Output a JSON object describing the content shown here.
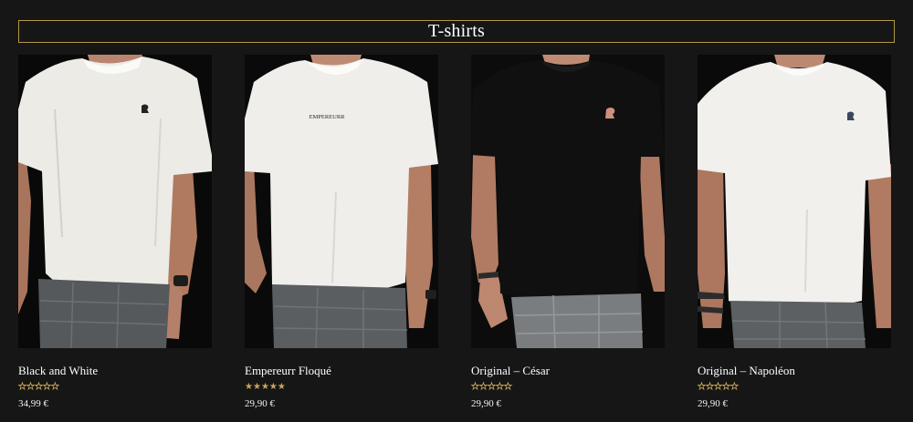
{
  "section": {
    "title": "T-shirts"
  },
  "colors": {
    "background": "#161616",
    "accent_gold": "#b39a45",
    "star_gold": "#c9a758"
  },
  "products": [
    {
      "name": "Black and White",
      "price": "34,99 €",
      "rating": 0,
      "shirt_color": "white",
      "print": "black-bust-logo-icon"
    },
    {
      "name": "Empereurr Floqué",
      "price": "29,90 €",
      "rating": 5,
      "shirt_color": "white",
      "print_text": "EMPEREURR"
    },
    {
      "name": "Original – César",
      "price": "29,90 €",
      "rating": 0,
      "shirt_color": "black",
      "print": "pink-bust-logo-icon"
    },
    {
      "name": "Original – Napoléon",
      "price": "29,90 €",
      "rating": 0,
      "shirt_color": "white",
      "print": "navy-bust-logo-icon"
    }
  ]
}
